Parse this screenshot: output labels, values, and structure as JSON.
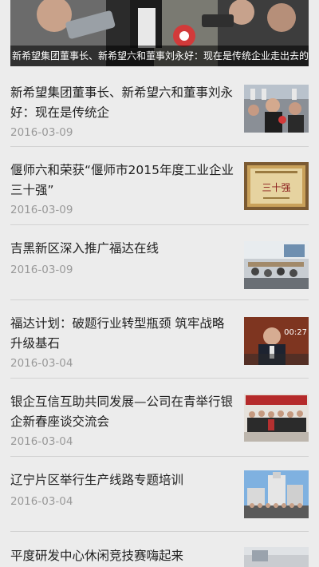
{
  "hero": {
    "caption": "新希望集团董事长、新希望六和董事刘永好：现在是传统企业走出去的好"
  },
  "news": [
    {
      "title": "新希望集团董事长、新希望六和董事刘永好：现在是传统企",
      "date": "2016-03-09",
      "thumb": "press-conference-photo"
    },
    {
      "title": "偃师六和荣获“偃师市2015年度工业企业三十强”",
      "date": "2016-03-09",
      "thumb": "award-plaque-photo",
      "plaque_text": "三十强"
    },
    {
      "title": "吉黑新区深入推广福达在线",
      "date": "2016-03-09",
      "thumb": "training-room-photo"
    },
    {
      "title": "福达计划：破题行业转型瓶颈 筑牢战略升级基石",
      "date": "2016-03-04",
      "thumb": "video-interview-thumbnail",
      "video_time": "00:27"
    },
    {
      "title": "银企互信互助共同发展—公司在青举行银企新春座谈交流会",
      "date": "2016-03-04",
      "thumb": "group-photo"
    },
    {
      "title": "辽宁片区举行生产线路专题培训",
      "date": "2016-03-04",
      "thumb": "factory-group-photo"
    },
    {
      "title": "平度研发中心休闲竞技赛嗨起来",
      "date": "",
      "thumb": "event-photo"
    }
  ]
}
